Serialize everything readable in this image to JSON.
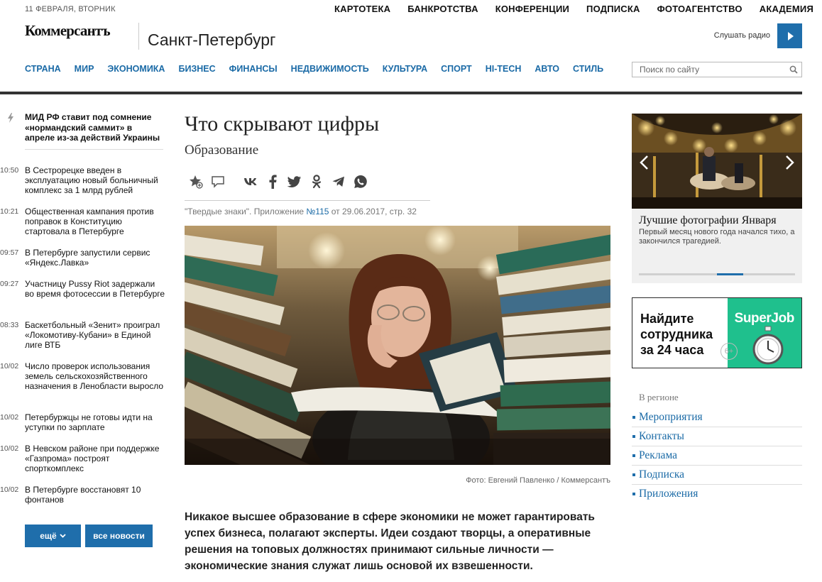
{
  "header": {
    "date": "11 ФЕВРАЛЯ, ВТОРНИК",
    "top_nav": [
      "КАРТОТЕКА",
      "БАНКРОТСТВА",
      "КОНФЕРЕНЦИИ",
      "ПОДПИСКА",
      "ФОТОАГЕНТСТВО",
      "АКАДЕМИЯ"
    ],
    "logo": "Коммерсантъ",
    "city": "Санкт-Петербург",
    "radio_label": "Слушать радио",
    "main_nav": [
      "СТРАНА",
      "МИР",
      "ЭКОНОМИКА",
      "БИЗНЕС",
      "ФИНАНСЫ",
      "НЕДВИЖИМОСТЬ",
      "КУЛЬТУРА",
      "СПОРТ",
      "HI-TECH",
      "АВТО",
      "СТИЛЬ"
    ],
    "search_placeholder": "Поиск по сайту"
  },
  "news_feed": {
    "lead": "МИД РФ ставит под сомнение «нормандский саммит» в апреле из-за действий Украины",
    "items": [
      {
        "time": "10:50",
        "title": "В Сестрорецке введен в эксплуатацию новый больничный комплекс за 1 млрд рублей"
      },
      {
        "time": "10:21",
        "title": "Общественная кампания против поправок в Конституцию стартовала в Петербурге"
      },
      {
        "time": "09:57",
        "title": "В Петербурге запустили сервис «Яндекс.Лавка»"
      },
      {
        "time": "09:27",
        "title": "Участницу Pussy Riot задержали во время фотосессии в Петербурге"
      },
      {
        "time": "08:33",
        "title": "Баскетбольный «Зенит» проиграл «Локомотиву-Кубани» в Единой лиге ВТБ"
      },
      {
        "time": "10/02",
        "title": "Число проверок использования земель сельскохозяйственного назначения в Ленобласти выросло"
      },
      {
        "time": "10/02",
        "title": "Петербуржцы не готовы идти на уступки по зарплате"
      },
      {
        "time": "10/02",
        "title": "В Невском районе при поддержке «Газпрома» построят спорткомплекс"
      },
      {
        "time": "10/02",
        "title": "В Петербурге восстановят 10 фонтанов"
      }
    ],
    "more_label": "ещё",
    "all_news_label": "все новости"
  },
  "article": {
    "title": "Что скрывают цифры",
    "rubric": "Образование",
    "source_prefix": "\"Твердые знаки\". Приложение ",
    "source_number": "№115",
    "source_suffix": " от 29.06.2017, стр. 32",
    "photo_credit": "Фото: Евгений Павленко / Коммерсантъ",
    "lead": "Никакое высшее образование в сфере экономики не может гарантировать успех бизнеса, полагают эксперты. Идеи создают творцы, а оперативные решения на топовых должностях принимают сильные личности — экономические знания служат лишь основой их взвешенности."
  },
  "gallery": {
    "title": "Лучшие фотографии Января",
    "description": "Первый месяц нового года начался тихо, а закончился трагедией."
  },
  "ad": {
    "text_line1": "Найдите",
    "text_line2": "сотрудника",
    "text_line3": "за 24 часа",
    "brand": "SuperJob",
    "age": "6+"
  },
  "region": {
    "label": "В регионе",
    "links": [
      "Мероприятия",
      "Контакты",
      "Реклама",
      "Подписка",
      "Приложения"
    ]
  },
  "colors": {
    "accent": "#1f6eab",
    "link": "#1a6aa6",
    "ad_green": "#1fc08d"
  }
}
